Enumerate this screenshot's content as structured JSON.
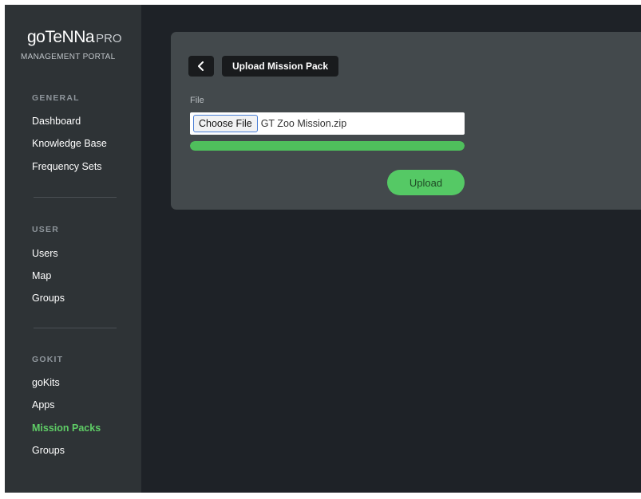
{
  "brand": {
    "name": "goTeNNa",
    "suffix": "PRO",
    "subtitle": "MANAGEMENT PORTAL"
  },
  "sidebar": {
    "sections": [
      {
        "title": "GENERAL",
        "items": [
          {
            "label": "Dashboard",
            "active": false
          },
          {
            "label": "Knowledge Base",
            "active": false
          },
          {
            "label": "Frequency Sets",
            "active": false
          }
        ]
      },
      {
        "title": "USER",
        "items": [
          {
            "label": "Users",
            "active": false
          },
          {
            "label": "Map",
            "active": false
          },
          {
            "label": "Groups",
            "active": false
          }
        ]
      },
      {
        "title": "GOKIT",
        "items": [
          {
            "label": "goKits",
            "active": false
          },
          {
            "label": "Apps",
            "active": false
          },
          {
            "label": "Mission Packs",
            "active": true
          },
          {
            "label": "Groups",
            "active": false
          }
        ]
      }
    ]
  },
  "main": {
    "back_icon": "chevron-left-icon",
    "page_title": "Upload Mission Pack",
    "file_label": "File",
    "choose_file_label": "Choose File",
    "file_name": "GT Zoo Mission.zip",
    "upload_progress_percent": 100,
    "upload_button_label": "Upload"
  },
  "colors": {
    "accent_green": "#55c965",
    "active_nav": "#5fcd66"
  }
}
